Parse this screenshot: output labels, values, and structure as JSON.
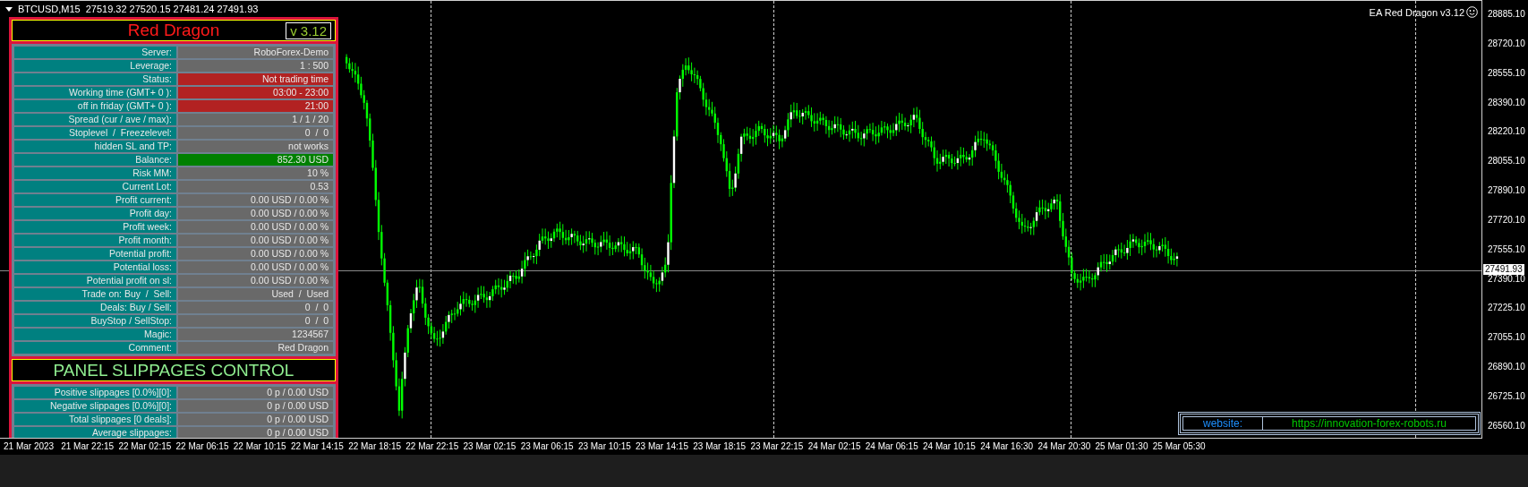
{
  "chart_header": {
    "symbol": "BTCUSD,M15",
    "prices": "27519.32 27520.15 27481.24 27491.93"
  },
  "indicator_label": "EA Red Dragon v3.12",
  "panel": {
    "title": "Red Dragon",
    "version": "v 3.12",
    "rows": [
      {
        "label": "Server:",
        "value": "RoboForex-Demo",
        "kind": "normal"
      },
      {
        "label": "Leverage:",
        "value": "1 : 500",
        "kind": "normal"
      },
      {
        "label": "Status:",
        "value": "Not trading time",
        "kind": "alert"
      },
      {
        "label": "Working time (GMT+ 0 ):",
        "value": "03:00 - 23:00",
        "kind": "alert"
      },
      {
        "label": "off in friday (GMT+ 0 ):",
        "value": "21:00",
        "kind": "alert"
      },
      {
        "label": "Spread (cur / ave / max):",
        "value": "1 / 1 / 20",
        "kind": "normal"
      },
      {
        "label": "Stoplevel  /  Freezelevel:",
        "value": "0  /  0",
        "kind": "normal"
      },
      {
        "label": "hidden SL and TP:",
        "value": "not works",
        "kind": "normal"
      },
      {
        "label": "Balance:",
        "value": "852.30 USD",
        "kind": "good"
      },
      {
        "label": "Risk MM:",
        "value": "10 %",
        "kind": "normal"
      },
      {
        "label": "Current Lot:",
        "value": "0.53",
        "kind": "normal"
      },
      {
        "label": "Profit current:",
        "value": "0.00 USD / 0.00 %",
        "kind": "normal"
      },
      {
        "label": "Profit day:",
        "value": "0.00 USD / 0.00 %",
        "kind": "normal"
      },
      {
        "label": "Profit week:",
        "value": "0.00 USD / 0.00 %",
        "kind": "normal"
      },
      {
        "label": "Profit month:",
        "value": "0.00 USD / 0.00 %",
        "kind": "normal"
      },
      {
        "label": "Potential profit:",
        "value": "0.00 USD / 0.00 %",
        "kind": "normal"
      },
      {
        "label": "Potential loss:",
        "value": "0.00 USD / 0.00 %",
        "kind": "normal"
      },
      {
        "label": "Potential profit on sl:",
        "value": "0.00 USD / 0.00 %",
        "kind": "normal"
      },
      {
        "label": "Trade on: Buy  /  Sell:",
        "value": "Used  /  Used",
        "kind": "normal"
      },
      {
        "label": "Deals: Buy / Sell:",
        "value": "0  /  0",
        "kind": "normal"
      },
      {
        "label": "BuyStop / SellStop:",
        "value": "0  /  0",
        "kind": "normal"
      },
      {
        "label": "Magic:",
        "value": "1234567",
        "kind": "normal"
      },
      {
        "label": "Comment:",
        "value": "Red Dragon",
        "kind": "normal"
      }
    ]
  },
  "slippages": {
    "title": "PANEL SLIPPAGES CONTROL",
    "rows": [
      {
        "label": "Positive slippages [0.0%][0]:",
        "value": "0 p / 0.00 USD"
      },
      {
        "label": "Negative slippages [0.0%][0]:",
        "value": "0 p / 0.00 USD"
      },
      {
        "label": "Total slippages [0 deals]:",
        "value": "0 p / 0.00 USD"
      },
      {
        "label": "Average slippages:",
        "value": "0 p / 0.00 USD"
      }
    ]
  },
  "website": {
    "label": "website:",
    "url": "https://innovation-forex-robots.ru"
  },
  "price_axis": {
    "ticks": [
      "28885.10",
      "28720.10",
      "28555.10",
      "28390.10",
      "28220.10",
      "28055.10",
      "27890.10",
      "27720.10",
      "27555.10",
      "27390.10",
      "27225.10",
      "27055.10",
      "26890.10",
      "26725.10",
      "26560.10"
    ],
    "current": "27491.93"
  },
  "time_axis": [
    "21 Mar 2023",
    "21 Mar 22:15",
    "22 Mar 02:15",
    "22 Mar 06:15",
    "22 Mar 10:15",
    "22 Mar 14:15",
    "22 Mar 18:15",
    "22 Mar 22:15",
    "23 Mar 02:15",
    "23 Mar 06:15",
    "23 Mar 10:15",
    "23 Mar 14:15",
    "23 Mar 18:15",
    "23 Mar 22:15",
    "24 Mar 02:15",
    "24 Mar 06:15",
    "24 Mar 10:15",
    "24 Mar 16:30",
    "24 Mar 20:30",
    "25 Mar 01:30",
    "25 Mar 05:30"
  ]
}
